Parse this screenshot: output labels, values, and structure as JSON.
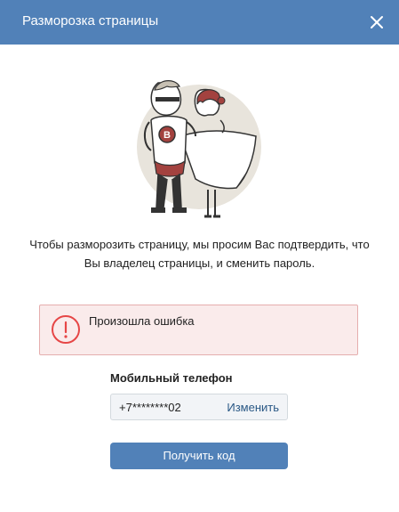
{
  "header": {
    "title": "Разморозка страницы",
    "close_icon": "close-icon"
  },
  "illustration": {
    "icon": "superhero-couple-illustration",
    "emblem_letter": "B"
  },
  "description": {
    "line1": "Чтобы разморозить страницу, мы просим Вас подтвердить, что",
    "line2": "Вы владелец страницы, и сменить пароль."
  },
  "error": {
    "icon": "error-icon",
    "message": "Произошла ошибка"
  },
  "phone": {
    "label": "Мобильный телефон",
    "value": "+7********02",
    "change_label": "Изменить"
  },
  "submit": {
    "label": "Получить код"
  },
  "colors": {
    "accent": "#5181b8",
    "error_bg": "#faebeb",
    "error_border": "#e5aeae",
    "error_icon": "#e64646",
    "link": "#2a5885"
  }
}
